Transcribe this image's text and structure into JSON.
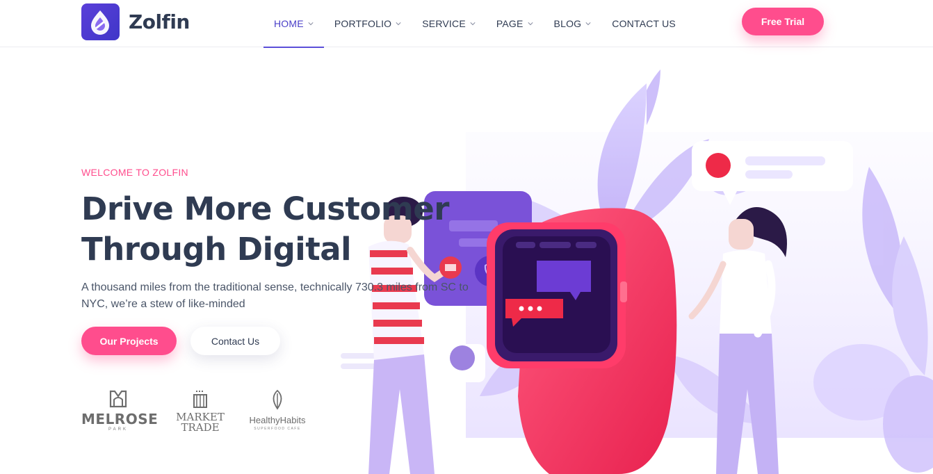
{
  "brand": {
    "name": "Zolfin"
  },
  "nav": {
    "items": [
      {
        "label": "HOME",
        "has_dropdown": true,
        "active": true
      },
      {
        "label": "PORTFOLIO",
        "has_dropdown": true
      },
      {
        "label": "SERVICE",
        "has_dropdown": true
      },
      {
        "label": "PAGE",
        "has_dropdown": true
      },
      {
        "label": "BLOG",
        "has_dropdown": true
      },
      {
        "label": "CONTACT US",
        "has_dropdown": false
      }
    ],
    "cta_label": "Free Trial"
  },
  "hero": {
    "eyebrow": "WELCOME TO ZOLFIN",
    "headline_line1": "Drive More Customer",
    "headline_line2": "Through Digital",
    "subtext": "A thousand miles from the traditional sense, technically 730.3 miles from SC to NYC, we’re a stew of like-minded",
    "primary_button": "Our Projects",
    "secondary_button": "Contact Us"
  },
  "partners": [
    {
      "name": "MELROSE",
      "sub": "PARK"
    },
    {
      "name_line1": "MARKET",
      "name_line2": "TRADE"
    },
    {
      "name": "HealthyHabits",
      "sub": "SUPERFOOD CAFE"
    }
  ],
  "colors": {
    "accent": "#ff4d8d",
    "primary": "#4a3fc8",
    "heading": "#2f3b52"
  }
}
